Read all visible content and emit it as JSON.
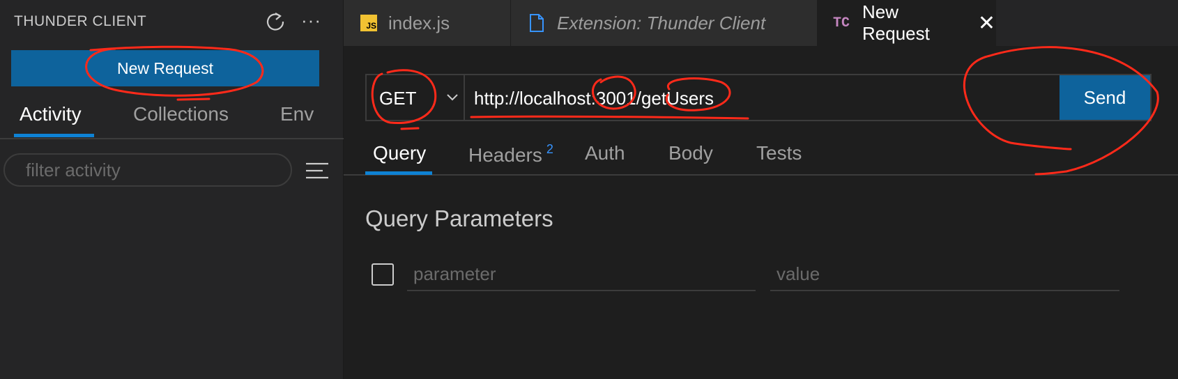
{
  "sidebar": {
    "title": "THUNDER CLIENT",
    "new_request_label": "New Request",
    "tabs": [
      {
        "label": "Activity"
      },
      {
        "label": "Collections"
      },
      {
        "label": "Env"
      }
    ],
    "active_tab": "Activity",
    "filter_placeholder": "filter activity"
  },
  "editor_tabs": [
    {
      "label": "index.js",
      "icon": "js-file-icon"
    },
    {
      "label": "Extension: Thunder Client",
      "icon": "file-icon"
    },
    {
      "label": "New Request",
      "icon": "thunder-client-icon",
      "icon_text": "TC",
      "active": true
    }
  ],
  "request": {
    "method": "GET",
    "url": "http://localhost:3001/getUsers",
    "send_label": "Send",
    "tabs": [
      {
        "label": "Query"
      },
      {
        "label": "Headers",
        "badge": "2"
      },
      {
        "label": "Auth"
      },
      {
        "label": "Body"
      },
      {
        "label": "Tests"
      }
    ],
    "active_tab": "Query"
  },
  "query_params": {
    "title": "Query Parameters",
    "parameter_placeholder": "parameter",
    "value_placeholder": "value"
  },
  "colors": {
    "accent": "#0e639c",
    "tab_underline": "#0e82d4",
    "annotation": "#ff2a1a",
    "badge": "#3794ff"
  }
}
